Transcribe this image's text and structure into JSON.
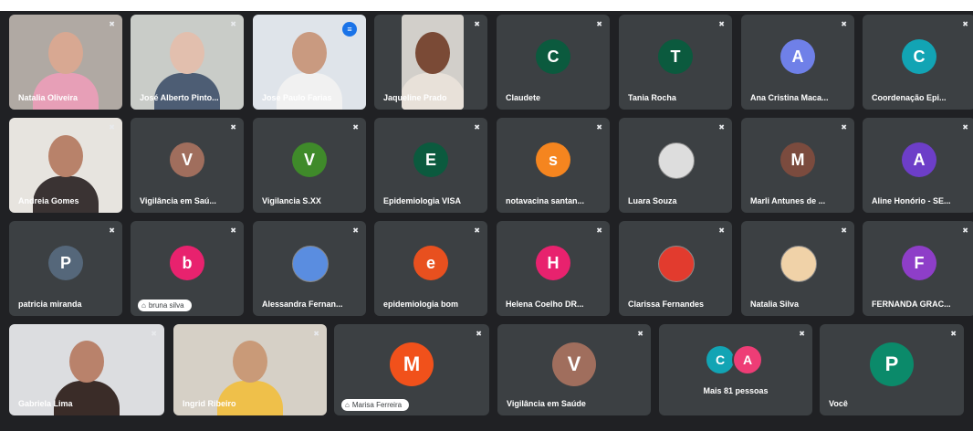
{
  "mic_icon": "mic-off-icon",
  "rows": [
    [
      {
        "name": "Natalia Oliveira",
        "video": true,
        "skin": "#d8a892",
        "bg": "#b0a9a3",
        "shirt": "#e79fb7"
      },
      {
        "name": "José Alberto Pinto...",
        "video": true,
        "skin": "#e2bfae",
        "bg": "#c9ccc8",
        "shirt": "#4d5d74"
      },
      {
        "name": "Jose Paulo Farias",
        "video": true,
        "skin": "#c99a80",
        "bg": "#dfe4ea",
        "shirt": "#f1f1f1",
        "speaking": true
      },
      {
        "name": "Jaqueline Prado",
        "video": true,
        "skin": "#7a4a36",
        "bg": "#d2cfca",
        "shirt": "#e8e1d9"
      },
      {
        "name": "Claudete",
        "initial": "C",
        "color": "#0b5a3e"
      },
      {
        "name": "Tania Rocha",
        "initial": "T",
        "color": "#0b5a3e"
      },
      {
        "name": "Ana Cristina Maca...",
        "initial": "A",
        "color": "#6f80e8"
      },
      {
        "name": "Coordenação Epi...",
        "initial": "C",
        "color": "#12a4b4"
      }
    ],
    [
      {
        "name": "Andreia Gomes",
        "video": true,
        "skin": "#b8826a",
        "bg": "#e7e4df",
        "shirt": "#3a3333"
      },
      {
        "name": "Vigilância em Saú...",
        "initial": "V",
        "color": "#a06e5d"
      },
      {
        "name": "Vigilancia S.XX",
        "initial": "V",
        "color": "#3f8a2a"
      },
      {
        "name": "Epidemiologia VISA",
        "initial": "E",
        "color": "#0b5a3e"
      },
      {
        "name": "notavacina santan...",
        "initial": "s",
        "color": "#f5851f"
      },
      {
        "name": "Luara Souza",
        "photoAvatar": "#ddd"
      },
      {
        "name": "Marli Antunes de ...",
        "initial": "M",
        "color": "#7b4b3e"
      },
      {
        "name": "Aline Honório - SE...",
        "initial": "A",
        "color": "#6d3ec8"
      }
    ],
    [
      {
        "name": "patricia miranda",
        "initial": "P",
        "color": "#55677a"
      },
      {
        "name": "bruna silva",
        "initial": "b",
        "color": "#e8226e",
        "pinned": true
      },
      {
        "name": "Alessandra Fernan...",
        "photoAvatar": "#5a8de0"
      },
      {
        "name": "epidemiologia bom",
        "initial": "e",
        "color": "#e8501f"
      },
      {
        "name": "Helena Coelho DR...",
        "initial": "H",
        "color": "#e8226e"
      },
      {
        "name": "Clarissa Fernandes",
        "photoAvatar": "#e23b2e"
      },
      {
        "name": "Natalia Silva",
        "photoAvatar": "#f0d2a8"
      },
      {
        "name": "FERNANDA GRAC...",
        "initial": "F",
        "color": "#8e3ec8"
      }
    ],
    [
      {
        "name": "Gabriela Lima",
        "video": true,
        "skin": "#b9826b",
        "bg": "#dcdde0",
        "shirt": "#3a2c28"
      },
      {
        "name": "Ingrid Ribeiro",
        "video": true,
        "skin": "#c99a78",
        "bg": "#d6d0c6",
        "shirt": "#efc04a"
      },
      {
        "name": "Marisa Ferreira",
        "initial": "M",
        "color": "#f1511b",
        "big": true,
        "pinned": true
      },
      {
        "name": "Vigilância em Saúde",
        "initial": "V",
        "color": "#a06e5d",
        "big": true
      },
      {
        "name": "Mais 81 pessoas",
        "pair": [
          "C",
          "A"
        ],
        "pairColors": [
          "#12a4b4",
          "#ee3d76"
        ]
      },
      {
        "name": "Você",
        "initial": "P",
        "color": "#0b8a6a",
        "big": true
      }
    ]
  ]
}
